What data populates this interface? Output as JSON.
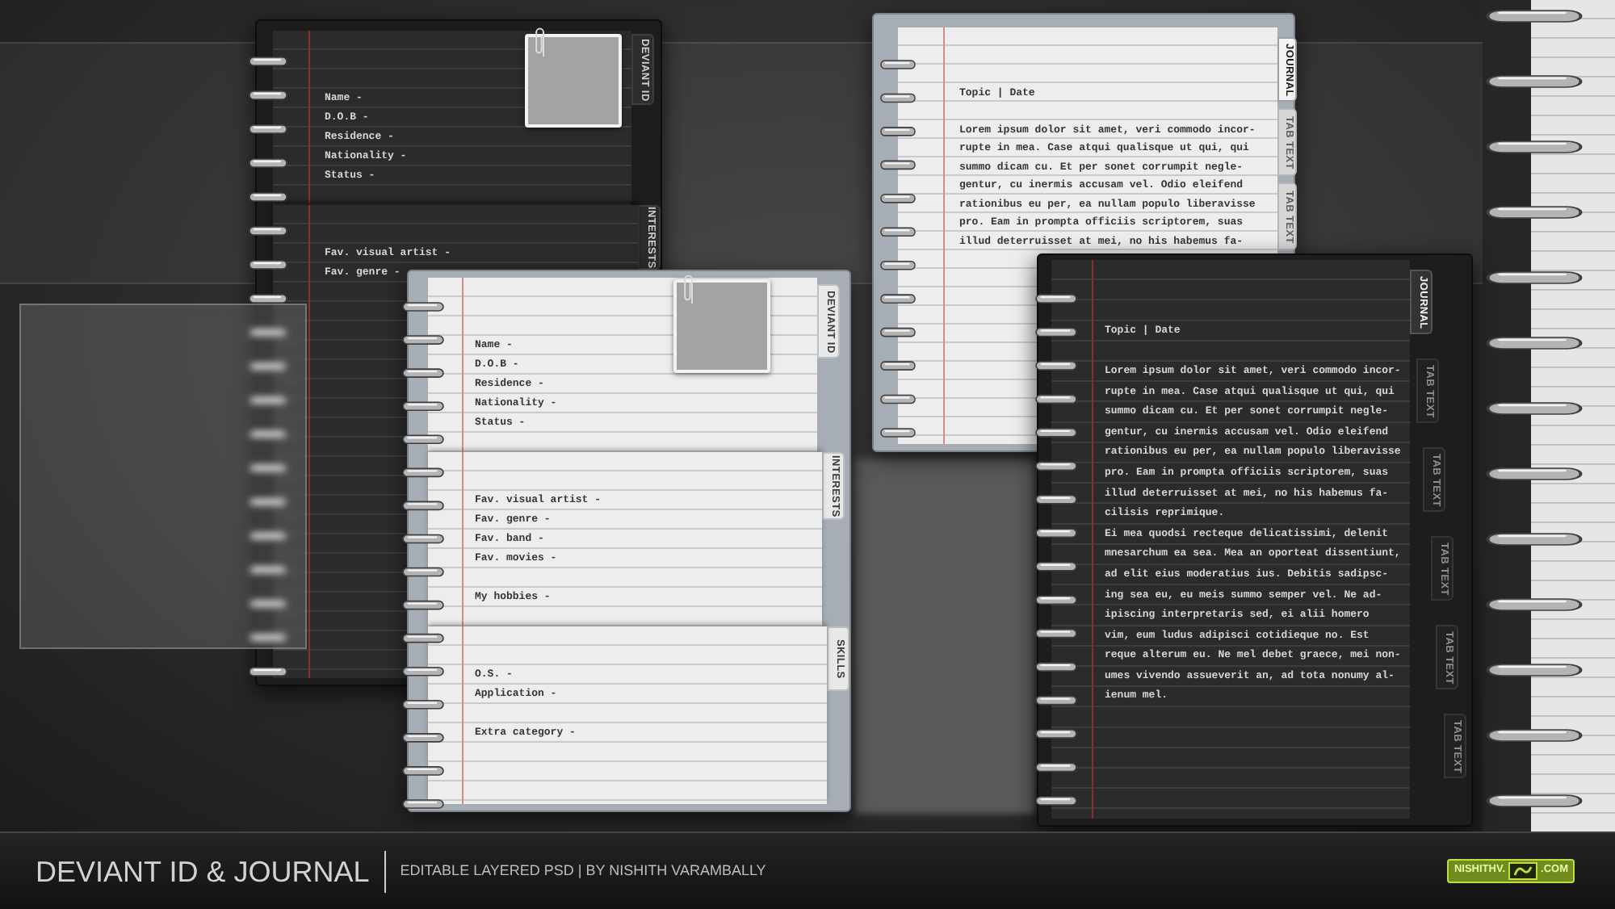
{
  "notebooks": [
    {
      "kind": "profile",
      "dark": true,
      "sections": [
        {
          "tab": "DEVIANT ID",
          "groups": [
            [
              "Name -",
              "D.O.B -",
              "Residence -",
              "Nationality -",
              "Status -"
            ]
          ]
        },
        {
          "tab": "INTERESTS",
          "groups": [
            [
              "Fav. visual artist -",
              "Fav. genre -"
            ]
          ]
        }
      ]
    },
    {
      "kind": "journal",
      "dark": false,
      "tabs": [
        {
          "label": "JOURNAL",
          "selected": true
        },
        {
          "label": "TAB TEXT",
          "selected": false
        },
        {
          "label": "TAB TEXT",
          "selected": false
        }
      ],
      "heading": "Topic | Date",
      "paragraphs": [
        [
          "Lorem ipsum dolor sit amet, veri commodo incor-",
          "rupte in mea. Case atqui qualisque ut qui, qui",
          "summo dicam cu. Et per sonet corrumpit negle-",
          "gentur, cu inermis accusam vel. Odio eleifend",
          "rationibus eu per, ea nullam populo liberavisse",
          "pro. Eam in prompta officiis scriptorem, suas",
          "illud deterruisset at mei, no his habemus fa-"
        ]
      ]
    },
    {
      "kind": "profile",
      "dark": false,
      "sections": [
        {
          "tab": "DEVIANT ID",
          "groups": [
            [
              "Name -",
              "D.O.B -",
              "Residence -",
              "Nationality -",
              "Status -"
            ]
          ]
        },
        {
          "tab": "INTERESTS",
          "groups": [
            [
              "Fav. visual artist -",
              "Fav. genre -",
              "Fav. band -",
              "Fav. movies -"
            ],
            [
              "My hobbies -"
            ]
          ]
        },
        {
          "tab": "SKILLS",
          "groups": [
            [
              "O.S. -",
              "Application -"
            ],
            [
              "Extra category -"
            ]
          ]
        }
      ]
    },
    {
      "kind": "journal",
      "dark": true,
      "tabs": [
        {
          "label": "JOURNAL",
          "selected": true
        },
        {
          "label": "TAB TEXT",
          "selected": false
        },
        {
          "label": "TAB TEXT",
          "selected": false
        },
        {
          "label": "TAB TEXT",
          "selected": false
        },
        {
          "label": "TAB TEXT",
          "selected": false
        },
        {
          "label": "TAB TEXT",
          "selected": false
        }
      ],
      "heading": "Topic | Date",
      "paragraphs": [
        [
          "Lorem ipsum dolor sit amet, veri commodo incor-",
          "rupte in mea. Case atqui qualisque ut qui, qui",
          "summo dicam cu. Et per sonet corrumpit negle-",
          "gentur, cu inermis accusam vel. Odio eleifend",
          "rationibus eu per, ea nullam populo liberavisse",
          "pro. Eam in prompta officiis scriptorem, suas",
          "illud deterruisset at mei, no his habemus fa-",
          "cilisis reprimique."
        ],
        [
          "Ei mea quodsi recteque delicatissimi, delenit",
          "mnesarchum ea sea. Mea an oporteat dissentiunt,",
          "ad elit eius moderatius ius. Debitis sadipsc-",
          "ing sea eu, eu meis summo semper vel. Ne ad-",
          "ipiscing interpretaris sed, ei alii homero",
          "vim, eum ludus adipisci cotidieque no. Est",
          "reque alterum eu. Ne mel debet graece, mei non-",
          "umes vivendo assueverit an, ad tota nonumy al-",
          "ienum mel."
        ]
      ]
    }
  ],
  "footer": {
    "title": "DEVIANT ID & JOURNAL",
    "subtitle": "EDITABLE LAYERED PSD | BY NISHITH VARAMBALLY",
    "logo": [
      "NISHITHV.",
      ".COM"
    ]
  }
}
